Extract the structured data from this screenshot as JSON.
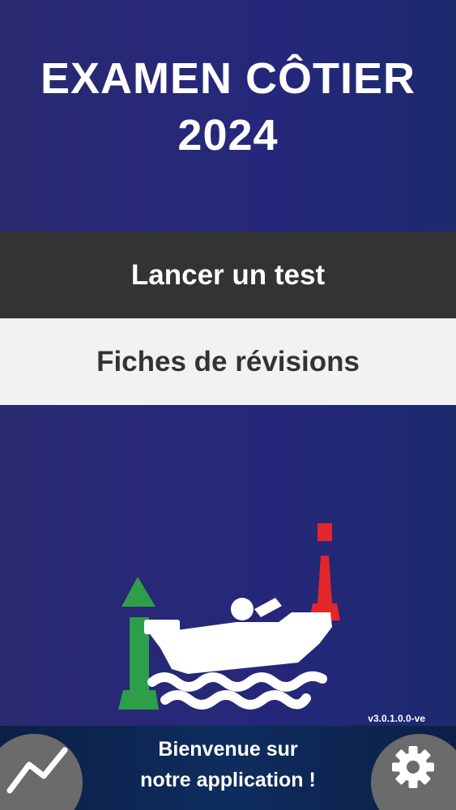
{
  "header": {
    "title_line1": "EXAMEN CÔTIER",
    "title_line2": "2024"
  },
  "menu": {
    "start_test_label": "Lancer un test",
    "revision_sheets_label": "Fiches de révisions"
  },
  "version": "v3.0.1.0.0-ve",
  "footer": {
    "welcome_line1": "Bienvenue sur",
    "welcome_line2": "notre application !",
    "left_icon": "stats-chart-icon",
    "right_icon": "gear-icon"
  },
  "colors": {
    "background": "#28286f",
    "start_button_bg": "#333333",
    "revision_button_bg": "#f2f2f2",
    "buoy_green": "#2e9e4b",
    "buoy_red": "#e3262c",
    "footer_bg": "#0e2a58"
  }
}
